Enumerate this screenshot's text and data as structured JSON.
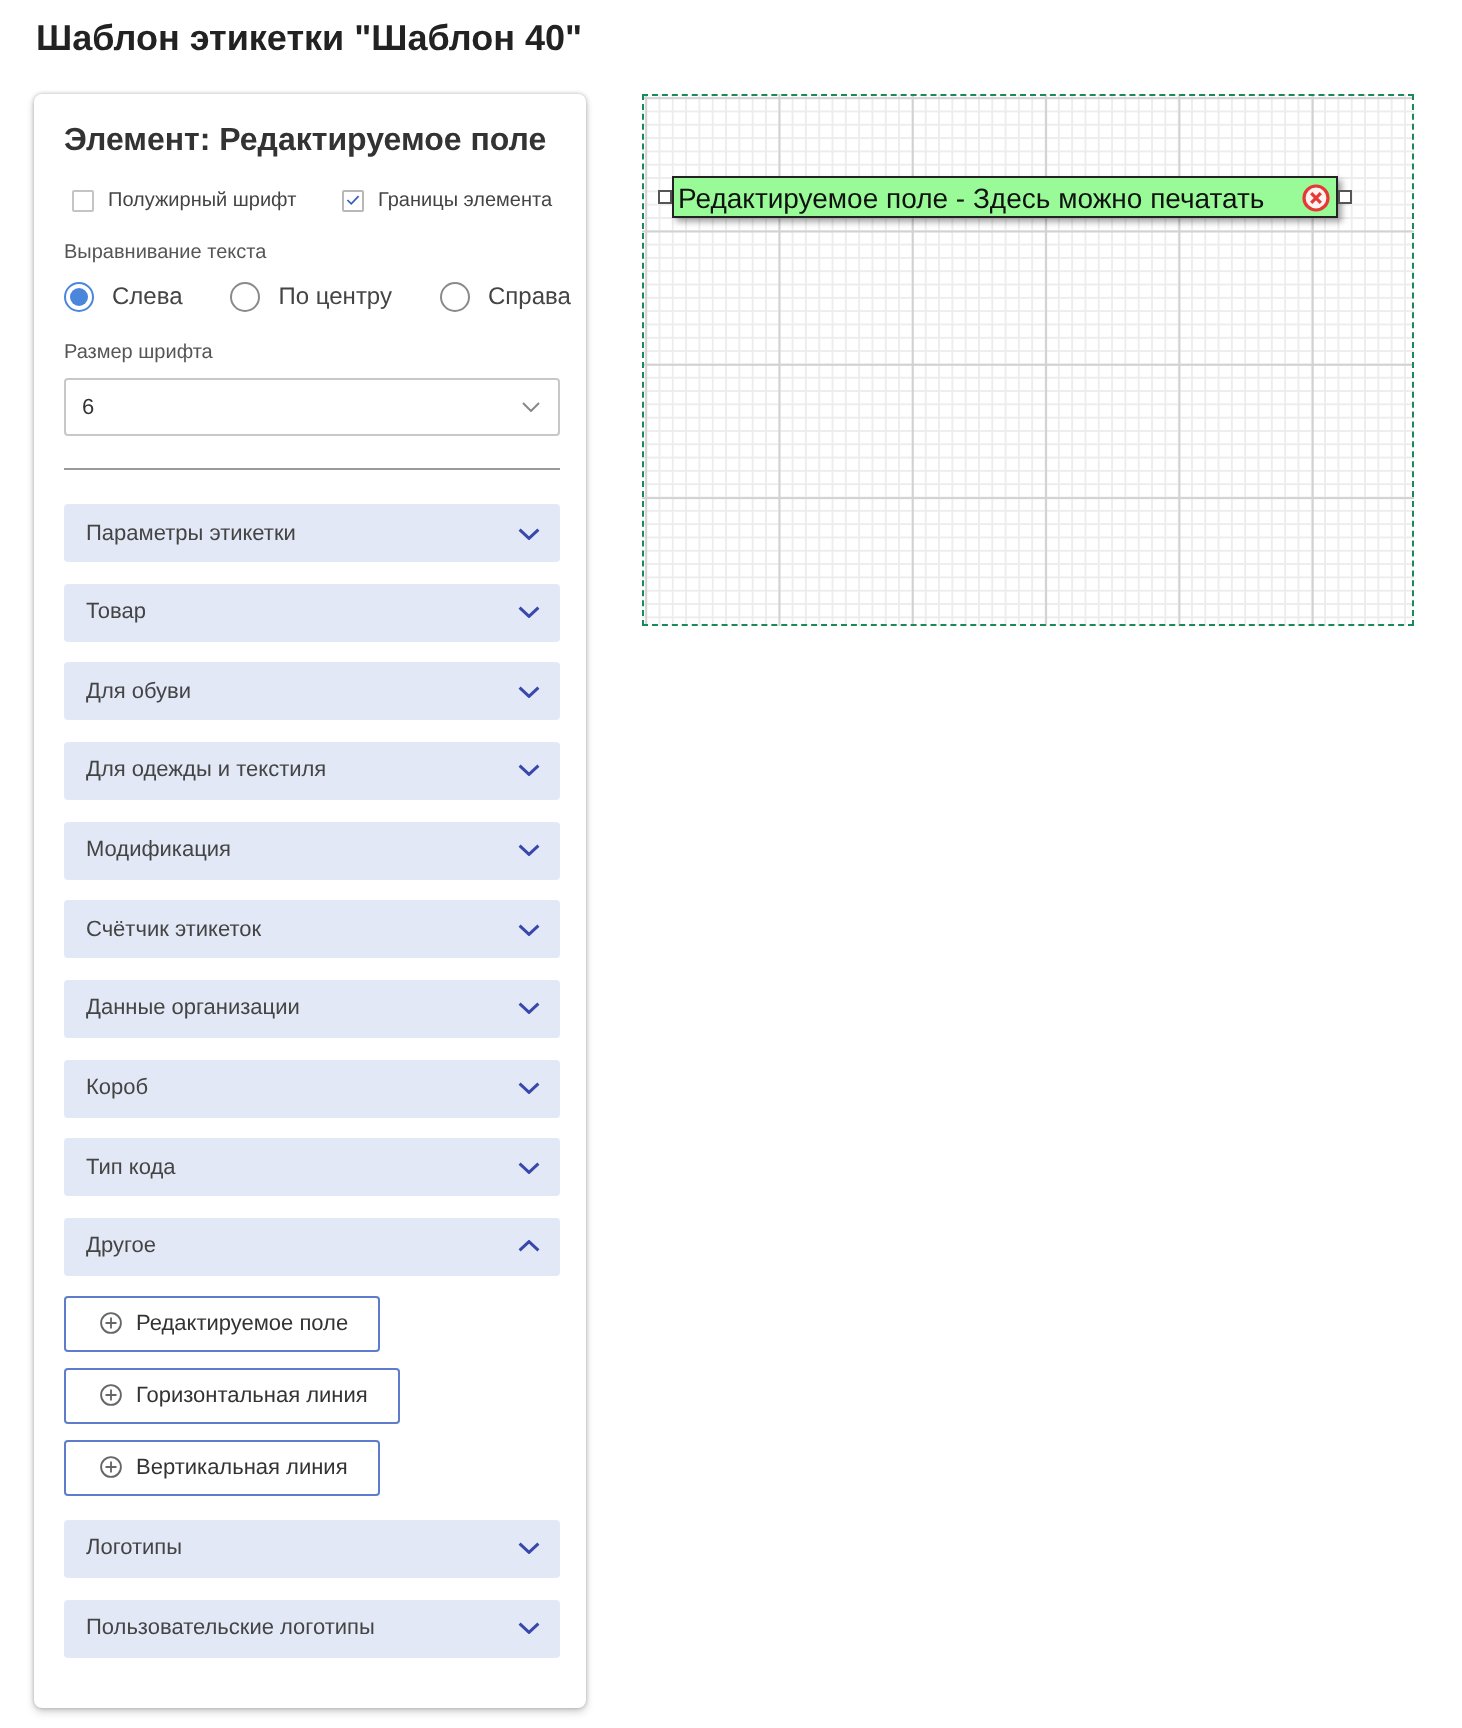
{
  "page": {
    "title": "Шаблон этикетки \"Шаблон 40\""
  },
  "panel": {
    "heading": "Элемент: Редактируемое поле",
    "checkboxes": [
      {
        "label": "Полужирный шрифт",
        "checked": false
      },
      {
        "label": "Границы элемента",
        "checked": true
      }
    ],
    "alignment": {
      "label": "Выравнивание текста",
      "options": [
        {
          "label": "Слева",
          "selected": true
        },
        {
          "label": "По центру",
          "selected": false
        },
        {
          "label": "Справа",
          "selected": false
        }
      ]
    },
    "font_size": {
      "label": "Размер шрифта",
      "value": "6"
    },
    "sections": [
      {
        "title": "Параметры этикетки",
        "expanded": false
      },
      {
        "title": "Товар",
        "expanded": false
      },
      {
        "title": "Для обуви",
        "expanded": false
      },
      {
        "title": "Для одежды и текстиля",
        "expanded": false
      },
      {
        "title": "Модификация",
        "expanded": false
      },
      {
        "title": "Счётчик этикеток",
        "expanded": false
      },
      {
        "title": "Данные организации",
        "expanded": false
      },
      {
        "title": "Короб",
        "expanded": false
      },
      {
        "title": "Тип кода",
        "expanded": false
      },
      {
        "title": "Другое",
        "expanded": true,
        "buttons": [
          "Редактируемое поле",
          "Горизонтальная линия",
          "Вертикальная линия"
        ]
      },
      {
        "title": "Логотипы",
        "expanded": false
      },
      {
        "title": "Пользовательские логотипы",
        "expanded": false
      }
    ]
  },
  "canvas": {
    "field": {
      "text": "Редактируемое поле - Здесь можно печатать"
    }
  }
}
